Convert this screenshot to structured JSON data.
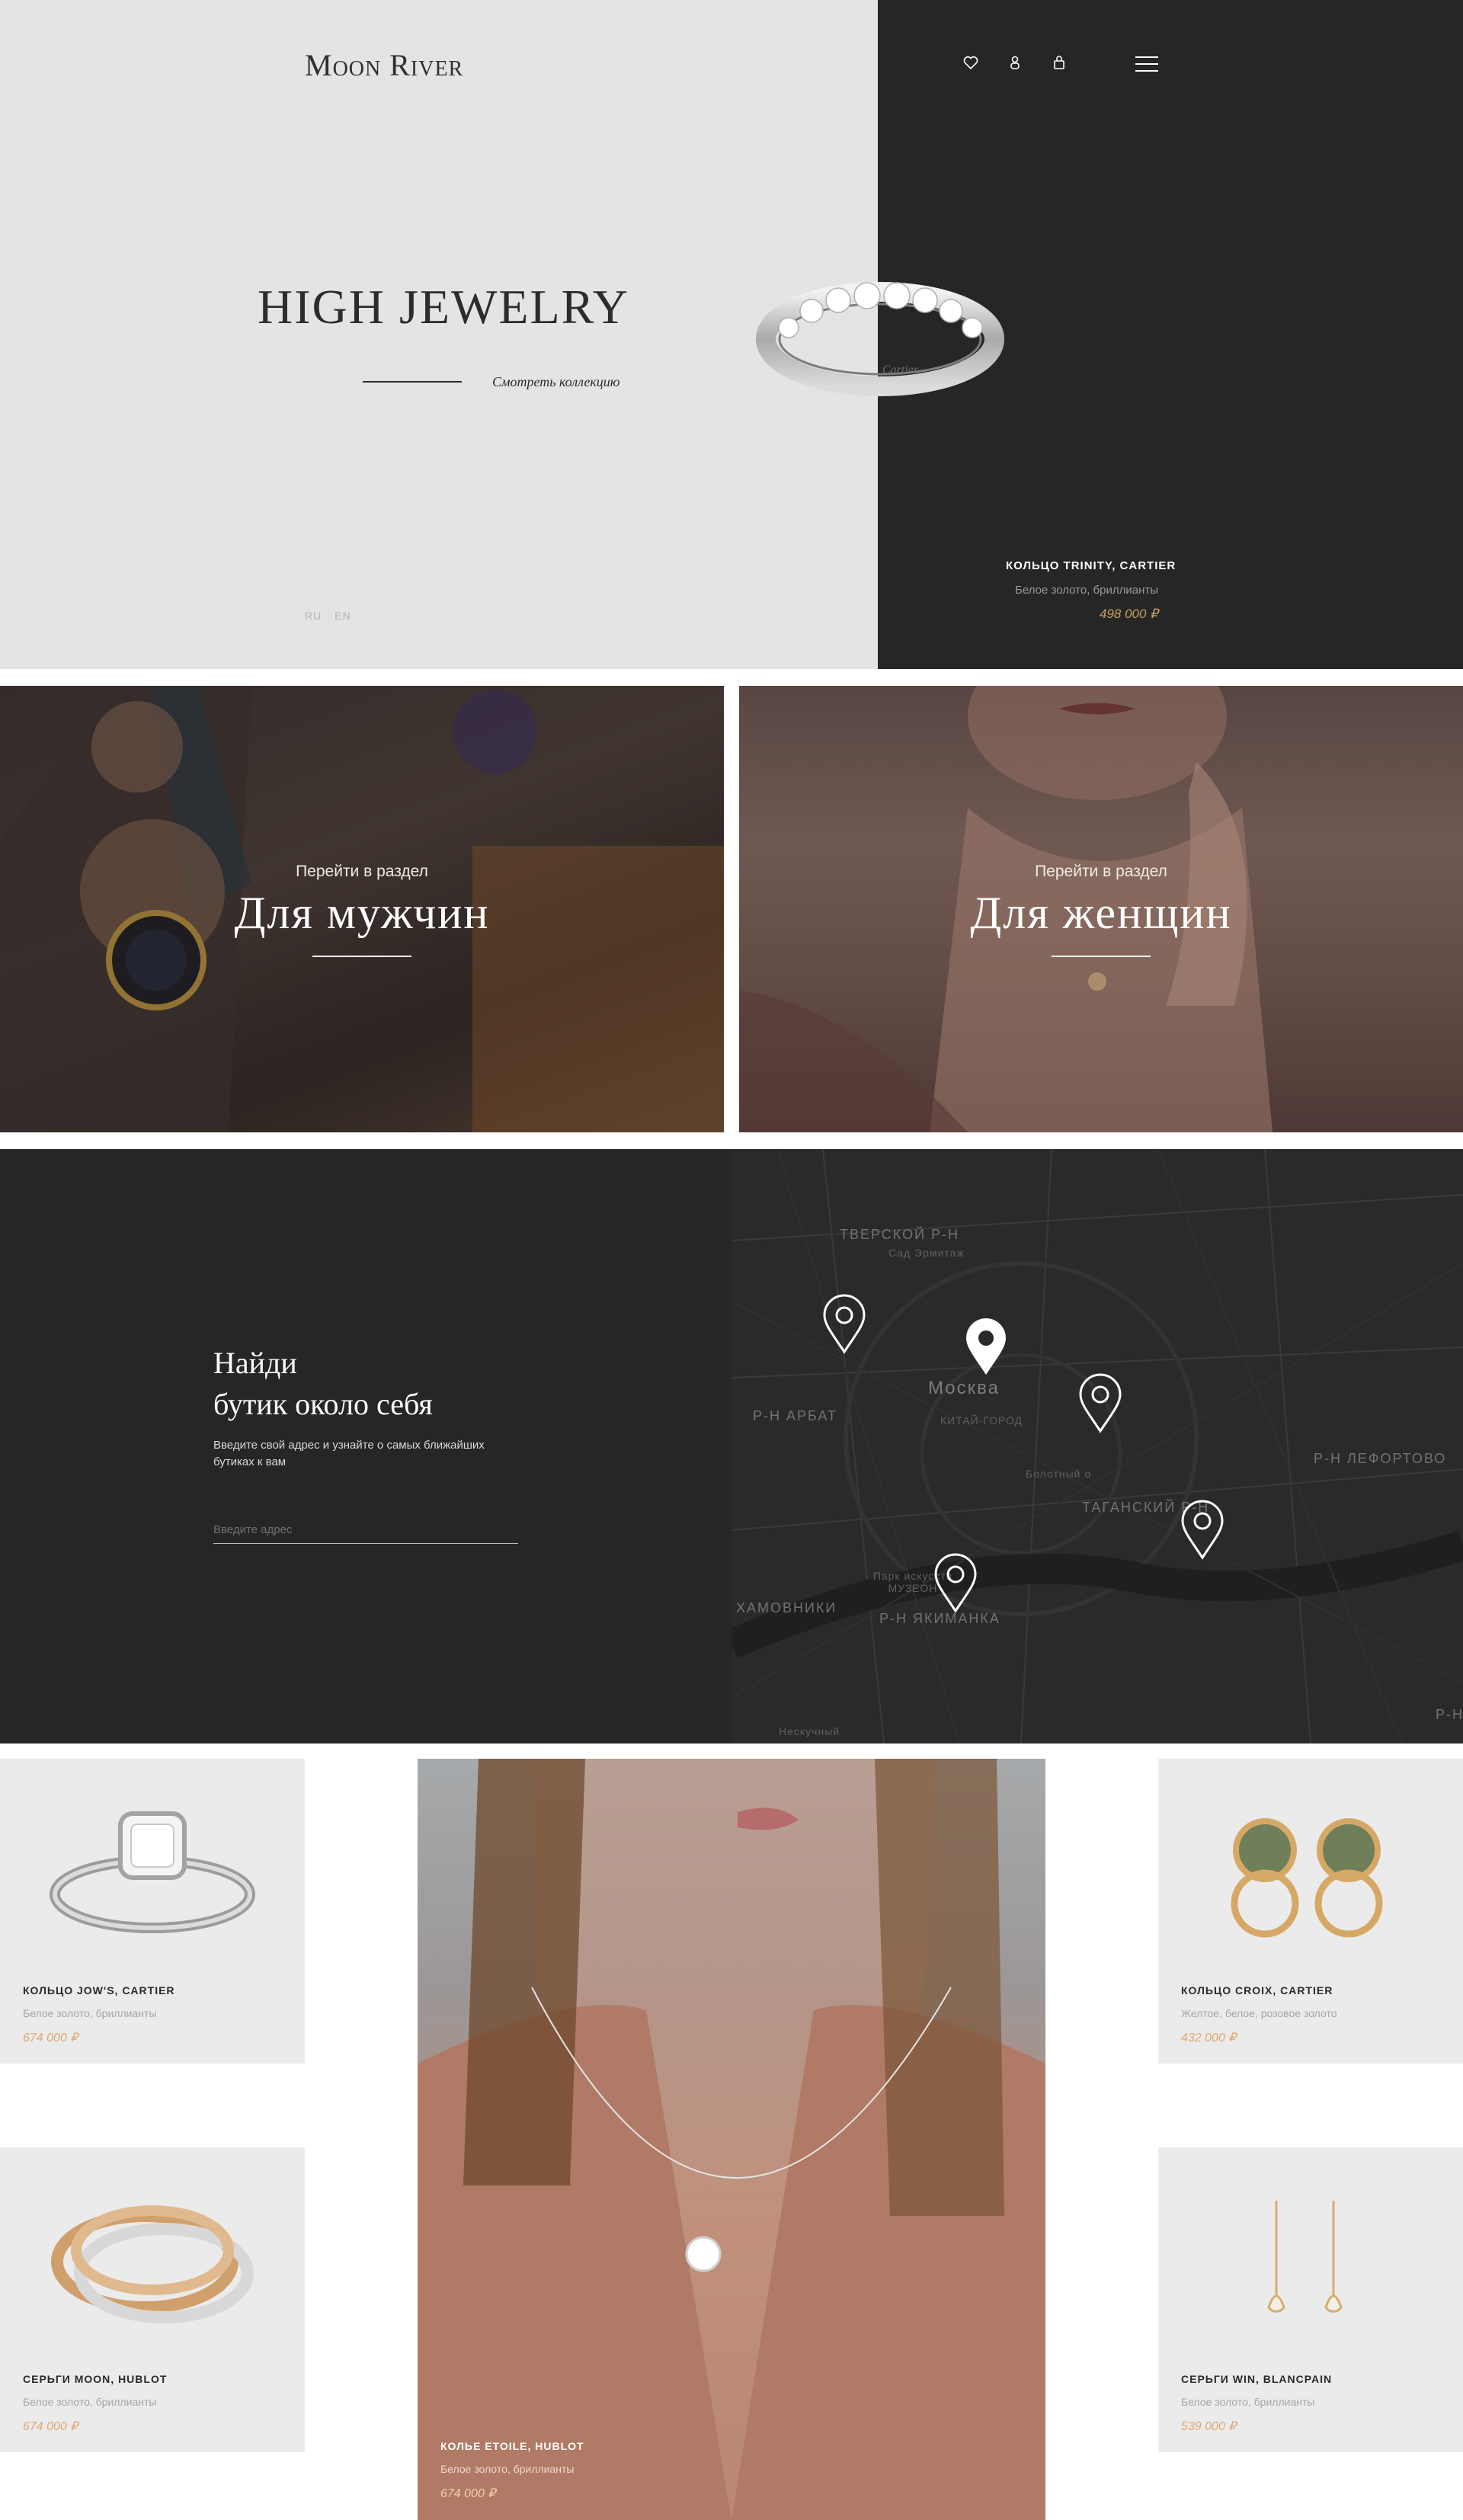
{
  "brand": {
    "logo": "Moon River"
  },
  "hero": {
    "title": "HIGH JEWELRY",
    "link_label": "Смотреть коллекцию",
    "languages": [
      "RU",
      "EN"
    ],
    "product": {
      "name": "КОЛЬЦО TRINITY, CARTIER",
      "description": "Белое золото, бриллианты",
      "price": "498 000 ₽"
    }
  },
  "header_icons": [
    "heart-icon",
    "user-icon",
    "bag-icon",
    "menu-icon"
  ],
  "categories": [
    {
      "pre": "Перейти в раздел",
      "title": "Для мужчин"
    },
    {
      "pre": "Перейти в раздел",
      "title": "Для женщин"
    }
  ],
  "finder": {
    "title_line1": "Найди",
    "title_line2": "бутик около себя",
    "subtitle": "Введите свой адрес и узнайте о самых ближайших бутиках к вам",
    "input_placeholder": "Введите адрес"
  },
  "map": {
    "labels": {
      "tverskoy": "ТВЕРСКОЙ Р-Н",
      "sad": "Сад Эрмитаж",
      "moscow": "Москва",
      "arbat": "Р-Н АРБАТ",
      "kitay": "КИТАЙ-ГОРОД",
      "bolotny": "Болотный о",
      "tagansky": "ТАГАНСКИЙ Р-Н",
      "lefortovo": "Р-Н ЛЕФОРТОВО",
      "park": "Парк искусств МУЗЕОН",
      "khamovniki": "ХАМОВНИКИ",
      "yakimanka": "Р-Н ЯКИМАНКА",
      "neskuchny": "Нескучный",
      "edge": "Р-Н"
    }
  },
  "products": [
    {
      "name": "КОЛЬЦО JOW'S, CARTIER",
      "description": "Белое золото, бриллианты",
      "price": "674 000 ₽"
    },
    {
      "name": "КОЛЬЦО CROIX, CARTIER",
      "description": "Желтое, белое, розовое золото",
      "price": "432 000 ₽"
    },
    {
      "name": "СЕРЬГИ MOON, HUBLOT",
      "description": "Белое золото, бриллианты",
      "price": "674 000 ₽"
    },
    {
      "name": "СЕРЬГИ WIN, BLANCPAIN",
      "description": "Белое золото, бриллианты",
      "price": "539 000 ₽"
    }
  ],
  "feature": {
    "name": "КОЛЬЕ ETOILE, HUBLOT",
    "description": "Белое золото, бриллианты",
    "price": "674 000 ₽"
  },
  "colors": {
    "hero_light": "#e4e4e4",
    "dark": "#262626",
    "price_gold": "#c9a063",
    "price_peach": "#e3a76f"
  }
}
